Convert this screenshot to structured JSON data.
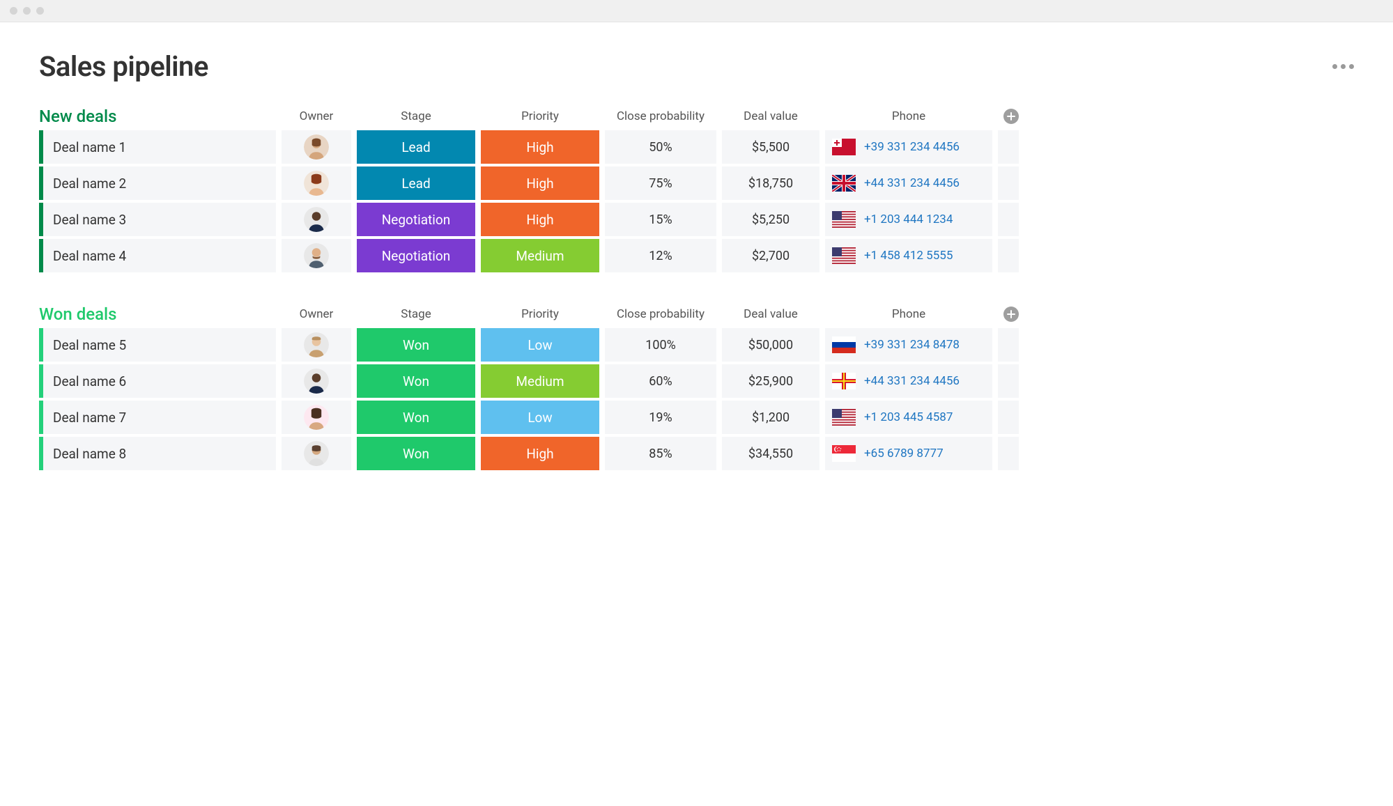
{
  "page": {
    "title": "Sales pipeline"
  },
  "columns": {
    "owner": "Owner",
    "stage": "Stage",
    "priority": "Priority",
    "close_probability": "Close probability",
    "deal_value": "Deal value",
    "phone": "Phone"
  },
  "colors": {
    "stage_lead": "#0288b0",
    "stage_negotiation": "#7b3bd1",
    "stage_won": "#1fc96b",
    "priority_high": "#f0652a",
    "priority_medium": "#85cc32",
    "priority_low": "#5fc0ef",
    "accent_new": "#008a4a",
    "accent_won": "#23d07a"
  },
  "sections": [
    {
      "title": "New deals",
      "accent": "accent_new",
      "title_color": "#008a4a",
      "rows": [
        {
          "name": "Deal name 1",
          "avatar": "f1",
          "stage": "Lead",
          "stage_color": "stage_lead",
          "priority": "High",
          "priority_color": "priority_high",
          "close_probability": "50%",
          "deal_value": "$5,500",
          "flag": "tonga",
          "phone": "+39 331 234 4456"
        },
        {
          "name": "Deal name 2",
          "avatar": "f2",
          "stage": "Lead",
          "stage_color": "stage_lead",
          "priority": "High",
          "priority_color": "priority_high",
          "close_probability": "75%",
          "deal_value": "$18,750",
          "flag": "uk",
          "phone": "+44 331 234 4456"
        },
        {
          "name": "Deal name 3",
          "avatar": "m1",
          "stage": "Negotiation",
          "stage_color": "stage_negotiation",
          "priority": "High",
          "priority_color": "priority_high",
          "close_probability": "15%",
          "deal_value": "$5,250",
          "flag": "us",
          "phone": "+1 203 444 1234"
        },
        {
          "name": "Deal name 4",
          "avatar": "m2",
          "stage": "Negotiation",
          "stage_color": "stage_negotiation",
          "priority": "Medium",
          "priority_color": "priority_medium",
          "close_probability": "12%",
          "deal_value": "$2,700",
          "flag": "us",
          "phone": "+1 458 412 5555"
        }
      ]
    },
    {
      "title": "Won deals",
      "accent": "accent_won",
      "title_color": "#1fc96b",
      "rows": [
        {
          "name": "Deal name 5",
          "avatar": "m3",
          "stage": "Won",
          "stage_color": "stage_won",
          "priority": "Low",
          "priority_color": "priority_low",
          "close_probability": "100%",
          "deal_value": "$50,000",
          "flag": "russia",
          "phone": "+39 331 234 8478"
        },
        {
          "name": "Deal name 6",
          "avatar": "m1",
          "stage": "Won",
          "stage_color": "stage_won",
          "priority": "Medium",
          "priority_color": "priority_medium",
          "close_probability": "60%",
          "deal_value": "$25,900",
          "flag": "guernsey",
          "phone": "+44 331 234 4456"
        },
        {
          "name": "Deal name 7",
          "avatar": "f3",
          "stage": "Won",
          "stage_color": "stage_won",
          "priority": "Low",
          "priority_color": "priority_low",
          "close_probability": "19%",
          "deal_value": "$1,200",
          "flag": "us",
          "phone": "+1 203 445 4587"
        },
        {
          "name": "Deal name 8",
          "avatar": "f4",
          "stage": "Won",
          "stage_color": "stage_won",
          "priority": "High",
          "priority_color": "priority_high",
          "close_probability": "85%",
          "deal_value": "$34,550",
          "flag": "singapore",
          "phone": "+65 6789 8777"
        }
      ]
    }
  ]
}
